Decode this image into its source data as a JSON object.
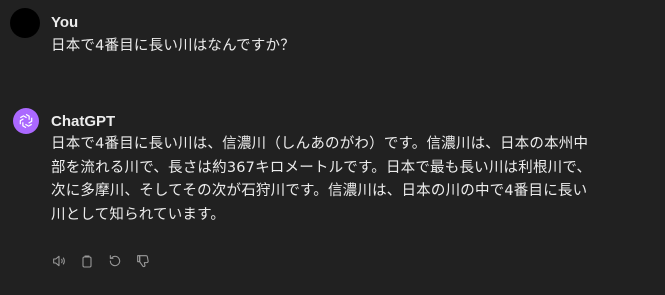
{
  "user_message": {
    "author": "You",
    "text": "日本で4番目に長い川はなんですか？"
  },
  "assistant_message": {
    "author": "ChatGPT",
    "lines": [
      "日本で4番目に長い川は、信濃川（しんあのがわ）です。信濃川は、日本の本州中",
      "部を流れる川で、長さは約367キロメートルです。日本で最も長い川は利根川で、",
      "次に多摩川、そしてその次が石狩川です。信濃川は、日本の川の中で4番目に長い",
      "川として知られています。"
    ]
  },
  "actions": {
    "icons": [
      "speaker-icon",
      "copy-icon",
      "regenerate-icon",
      "thumbs-down-icon"
    ]
  },
  "colors": {
    "background": "#212121",
    "text": "#ececec",
    "gpt_avatar": "#ab68ff",
    "icon": "#9b9b9b"
  }
}
